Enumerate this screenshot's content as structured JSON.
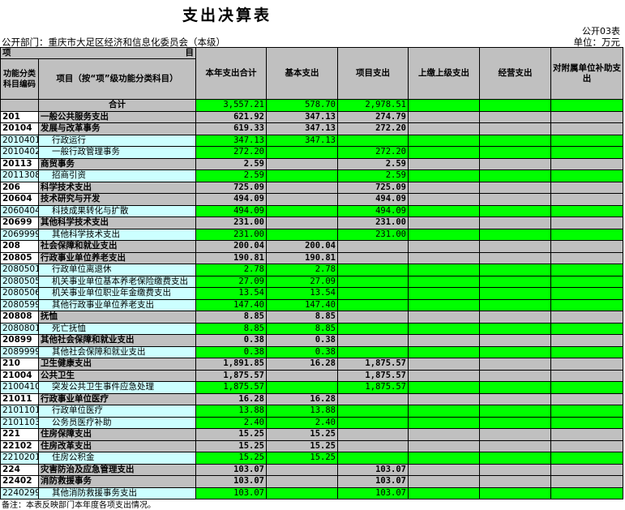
{
  "title": "支出决算表",
  "table_code": "公开03表",
  "department": "公开部门：重庆市大足区经济和信息化委员会（本级）",
  "unit": "单位：万元",
  "header": {
    "item_left": "项",
    "item_right": "目",
    "code_col": "功能分类科目编码",
    "name_col": "项目（按“项”级功能分类科目）",
    "total": "本年支出合计",
    "basic": "基本支出",
    "project": "项目支出",
    "upper": "上缴上级支出",
    "business": "经营支出",
    "subsidiary": "对附属单位补助支出"
  },
  "total_row": {
    "label": "合计",
    "total": "3,557.21",
    "basic": "578.70",
    "project": "2,978.51"
  },
  "rows": [
    {
      "level": 1,
      "code": "201",
      "name": "一般公共服务支出",
      "total": "621.92",
      "basic": "347.13",
      "project": "274.79"
    },
    {
      "level": 2,
      "code": "20104",
      "name": "发展与改革事务",
      "total": "619.33",
      "basic": "347.13",
      "project": "272.20"
    },
    {
      "level": 3,
      "code": "2010401",
      "name": "行政运行",
      "total": "347.13",
      "basic": "347.13",
      "project": ""
    },
    {
      "level": 3,
      "code": "2010402",
      "name": "一般行政管理事务",
      "total": "272.20",
      "basic": "",
      "project": "272.20"
    },
    {
      "level": 2,
      "code": "20113",
      "name": "商贸事务",
      "total": "2.59",
      "basic": "",
      "project": "2.59"
    },
    {
      "level": 3,
      "code": "2011308",
      "name": "招商引资",
      "total": "2.59",
      "basic": "",
      "project": "2.59"
    },
    {
      "level": 1,
      "code": "206",
      "name": "科学技术支出",
      "total": "725.09",
      "basic": "",
      "project": "725.09"
    },
    {
      "level": 2,
      "code": "20604",
      "name": "技术研究与开发",
      "total": "494.09",
      "basic": "",
      "project": "494.09"
    },
    {
      "level": 3,
      "code": "2060404",
      "name": "科技成果转化与扩散",
      "total": "494.09",
      "basic": "",
      "project": "494.09"
    },
    {
      "level": 2,
      "code": "20699",
      "name": "其他科学技术支出",
      "total": "231.00",
      "basic": "",
      "project": "231.00"
    },
    {
      "level": 3,
      "code": "2069999",
      "name": "其他科学技术支出",
      "total": "231.00",
      "basic": "",
      "project": "231.00"
    },
    {
      "level": 1,
      "code": "208",
      "name": "社会保障和就业支出",
      "total": "200.04",
      "basic": "200.04",
      "project": ""
    },
    {
      "level": 2,
      "code": "20805",
      "name": "行政事业单位养老支出",
      "total": "190.81",
      "basic": "190.81",
      "project": ""
    },
    {
      "level": 3,
      "code": "2080501",
      "name": "行政单位离退休",
      "total": "2.78",
      "basic": "2.78",
      "project": ""
    },
    {
      "level": 3,
      "code": "2080505",
      "name": "机关事业单位基本养老保险缴费支出",
      "total": "27.09",
      "basic": "27.09",
      "project": ""
    },
    {
      "level": 3,
      "code": "2080506",
      "name": "机关事业单位职业年金缴费支出",
      "total": "13.54",
      "basic": "13.54",
      "project": ""
    },
    {
      "level": 3,
      "code": "2080599",
      "name": "其他行政事业单位养老支出",
      "total": "147.40",
      "basic": "147.40",
      "project": ""
    },
    {
      "level": 2,
      "code": "20808",
      "name": "抚恤",
      "total": "8.85",
      "basic": "8.85",
      "project": ""
    },
    {
      "level": 3,
      "code": "2080801",
      "name": "死亡抚恤",
      "total": "8.85",
      "basic": "8.85",
      "project": ""
    },
    {
      "level": 2,
      "code": "20899",
      "name": "其他社会保障和就业支出",
      "total": "0.38",
      "basic": "0.38",
      "project": ""
    },
    {
      "level": 3,
      "code": "2089999",
      "name": "其他社会保障和就业支出",
      "total": "0.38",
      "basic": "0.38",
      "project": ""
    },
    {
      "level": 1,
      "code": "210",
      "name": "卫生健康支出",
      "total": "1,891.85",
      "basic": "16.28",
      "project": "1,875.57"
    },
    {
      "level": 2,
      "code": "21004",
      "name": "公共卫生",
      "total": "1,875.57",
      "basic": "",
      "project": "1,875.57"
    },
    {
      "level": 3,
      "code": "2100410",
      "name": "突发公共卫生事件应急处理",
      "total": "1,875.57",
      "basic": "",
      "project": "1,875.57"
    },
    {
      "level": 2,
      "code": "21011",
      "name": "行政事业单位医疗",
      "total": "16.28",
      "basic": "16.28",
      "project": ""
    },
    {
      "level": 3,
      "code": "2101101",
      "name": "行政单位医疗",
      "total": "13.88",
      "basic": "13.88",
      "project": ""
    },
    {
      "level": 3,
      "code": "2101103",
      "name": "公务员医疗补助",
      "total": "2.40",
      "basic": "2.40",
      "project": ""
    },
    {
      "level": 1,
      "code": "221",
      "name": "住房保障支出",
      "total": "15.25",
      "basic": "15.25",
      "project": ""
    },
    {
      "level": 2,
      "code": "22102",
      "name": "住房改革支出",
      "total": "15.25",
      "basic": "15.25",
      "project": ""
    },
    {
      "level": 3,
      "code": "2210201",
      "name": "住房公积金",
      "total": "15.25",
      "basic": "15.25",
      "project": ""
    },
    {
      "level": 1,
      "code": "224",
      "name": "灾害防治及应急管理支出",
      "total": "103.07",
      "basic": "",
      "project": "103.07"
    },
    {
      "level": 2,
      "code": "22402",
      "name": "消防救援事务",
      "total": "103.07",
      "basic": "",
      "project": "103.07"
    },
    {
      "level": 3,
      "code": "2240299",
      "name": "其他消防救援事务支出",
      "total": "103.07",
      "basic": "",
      "project": "103.07"
    }
  ],
  "note": "备注：本表反映部门本年度各项支出情况。",
  "colors": {
    "green": "#00ff00",
    "gray": "#c0c0c0",
    "cyan": "#ccffff"
  }
}
